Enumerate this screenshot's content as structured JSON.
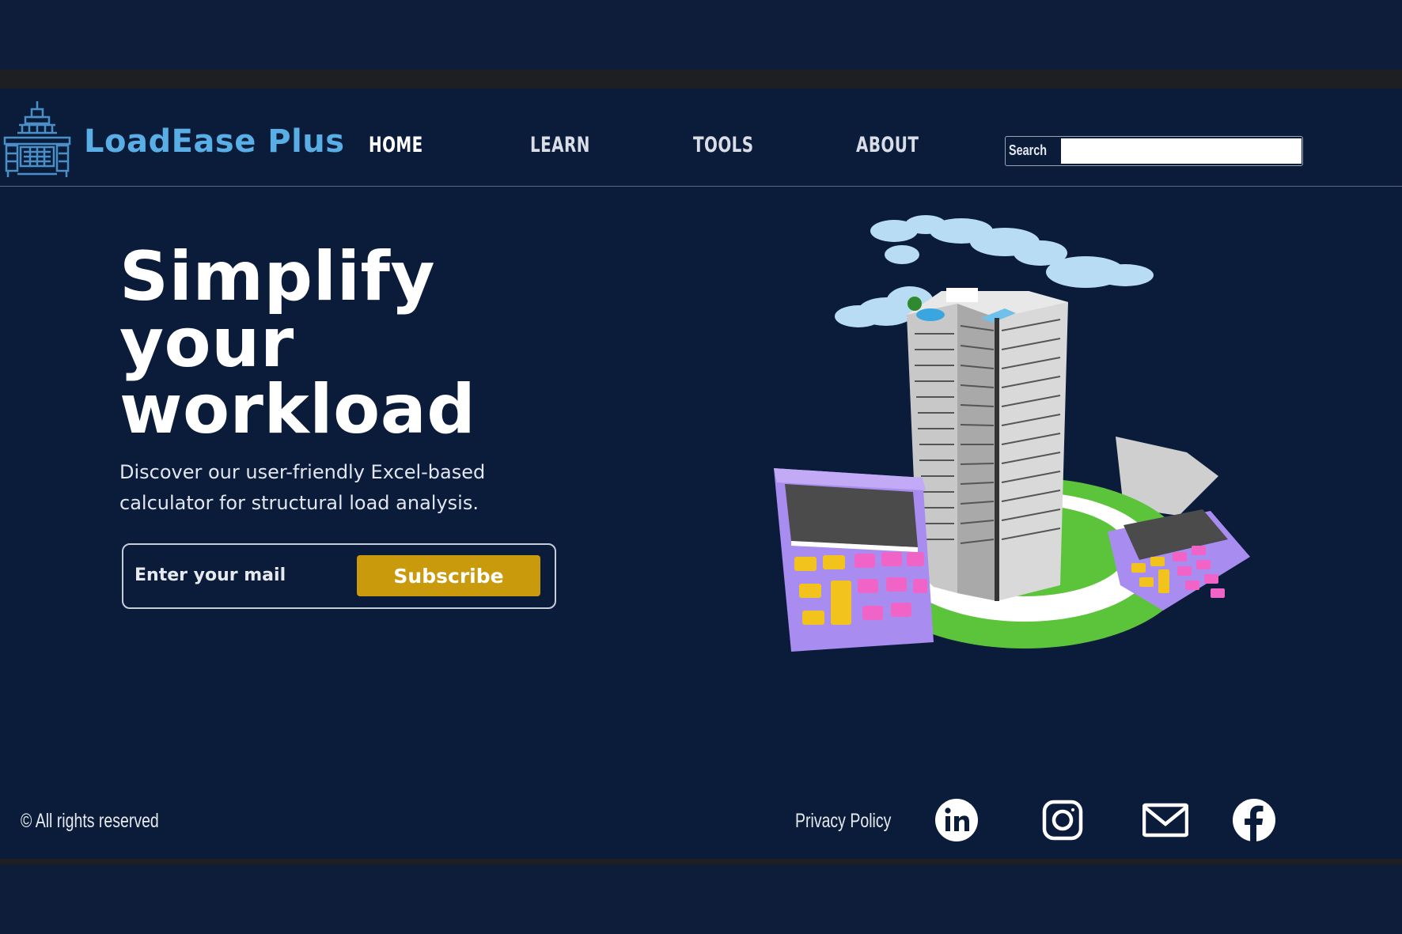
{
  "brand": {
    "name": "LoadEase Plus",
    "logo_icon": "bridge-logo-icon",
    "color": "#5aaee6"
  },
  "nav": {
    "items": [
      {
        "label": "HOME",
        "active": true
      },
      {
        "label": "LEARN",
        "active": false
      },
      {
        "label": "TOOLS",
        "active": false
      },
      {
        "label": "ABOUT",
        "active": false
      }
    ]
  },
  "search": {
    "label": "Search",
    "value": ""
  },
  "hero": {
    "title_lines": [
      "Simplify",
      "your",
      "workload"
    ],
    "subtitle": "Discover our user-friendly Excel-based calculator for structural load analysis.",
    "email_placeholder": "Enter your mail",
    "subscribe_label": "Subscribe",
    "accent_color": "#c99a0c",
    "illustration_icon": "building-calculators-illustration"
  },
  "footer": {
    "copyright": "© All rights reserved",
    "privacy": "Privacy Policy",
    "social_icons": [
      "linkedin-icon",
      "instagram-icon",
      "mail-icon",
      "facebook-icon"
    ]
  },
  "colors": {
    "background": "#0b1c3b",
    "text": "#ffffff"
  }
}
